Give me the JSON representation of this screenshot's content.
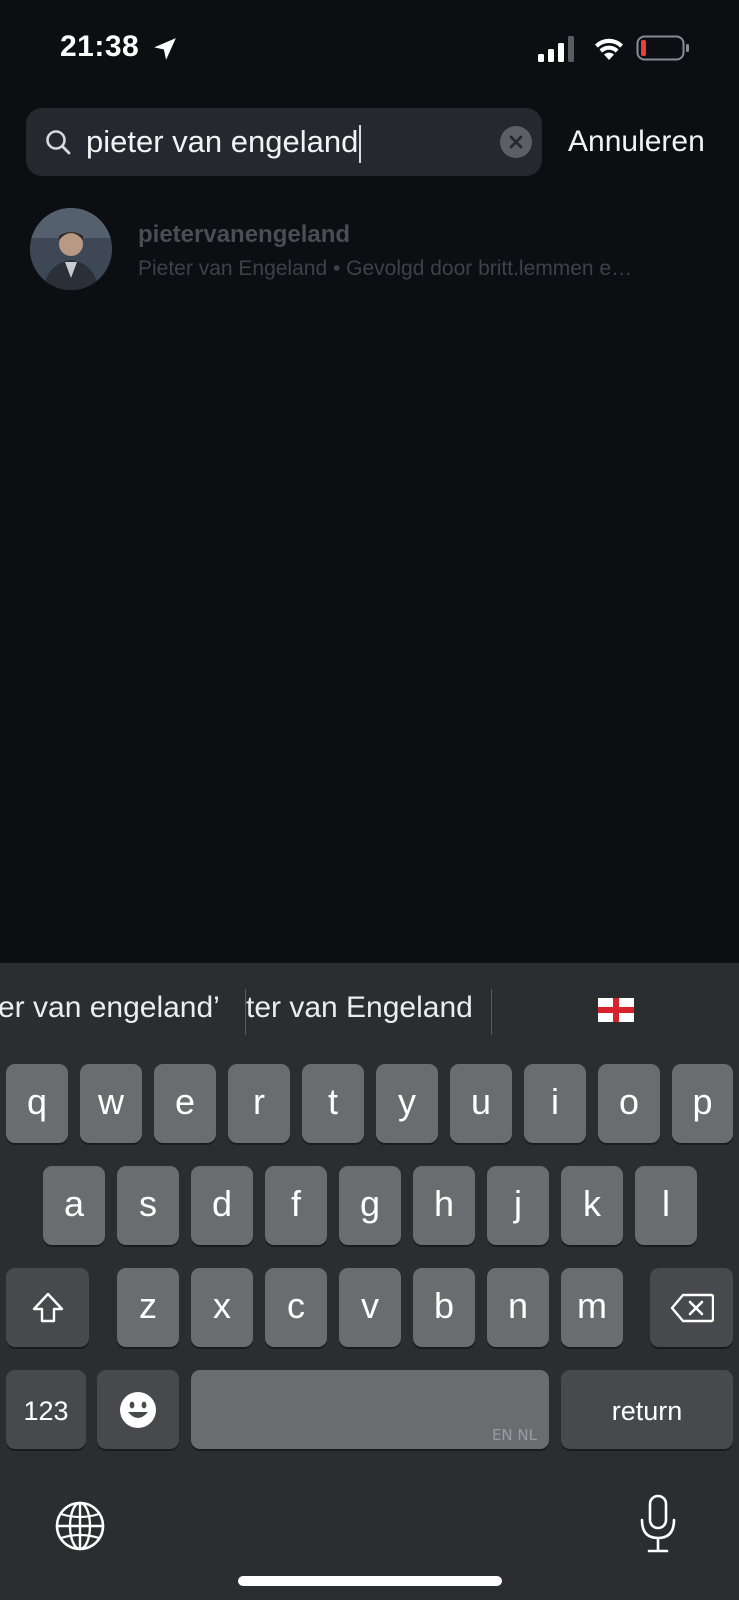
{
  "status_bar": {
    "time": "21:38",
    "icons": [
      "location-arrow-icon",
      "cellular-signal-icon",
      "wifi-icon",
      "battery-low-icon"
    ],
    "battery_color": "#e5403a"
  },
  "search": {
    "value": "pieter van engeland",
    "cancel_label": "Annuleren"
  },
  "results": [
    {
      "username": "pietervanengeland",
      "subtitle": "Pieter van Engeland • Gevolgd door britt.lemmen e…"
    }
  ],
  "keyboard": {
    "suggestions": [
      "er van engeland’",
      "ter van Engeland"
    ],
    "suggestion_emoji": "england-flag-icon",
    "rows": [
      [
        "q",
        "w",
        "e",
        "r",
        "t",
        "y",
        "u",
        "i",
        "o",
        "p"
      ],
      [
        "a",
        "s",
        "d",
        "f",
        "g",
        "h",
        "j",
        "k",
        "l"
      ],
      [
        "z",
        "x",
        "c",
        "v",
        "b",
        "n",
        "m"
      ]
    ],
    "numbers_label": "123",
    "space_lang_label": "EN NL",
    "return_label": "return"
  },
  "colors": {
    "background": "#0c0e12",
    "keyboard_bg": "#2c2d31",
    "key": "#6b6c70",
    "key_dark": "#48494d"
  }
}
